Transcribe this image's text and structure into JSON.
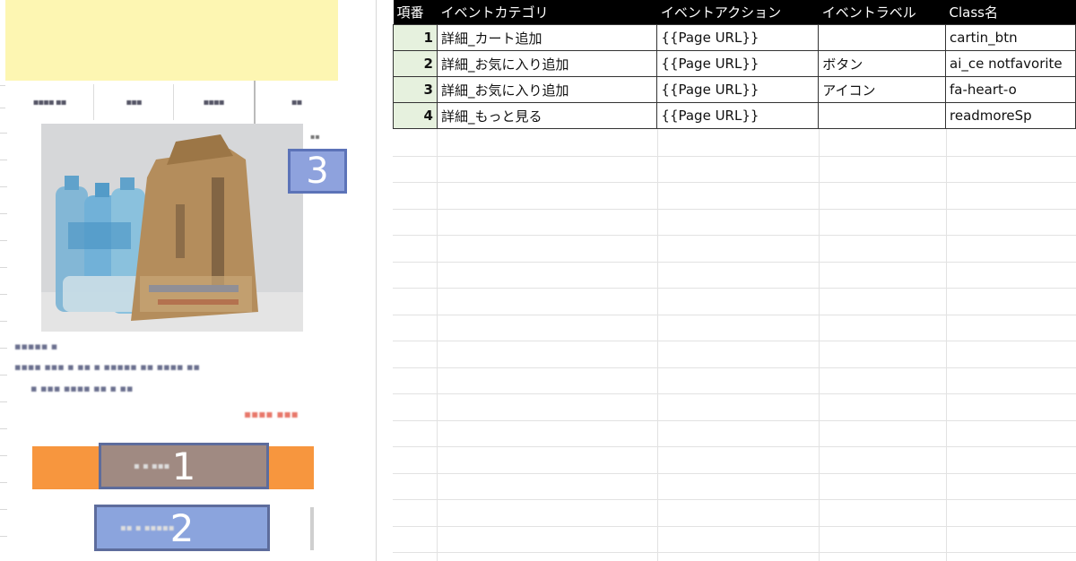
{
  "phone": {
    "tabs": [
      "▪▪▪▪ ▪▪",
      "▪▪▪",
      "▪▪▪▪",
      "▪▪"
    ],
    "marker3": "3",
    "marker3_tag": "▪▪",
    "product_title": "▪▪▪▪▪ ▪",
    "product_desc_1": "▪▪▪▪ ▪▪▪ ▪ ▪▪ ▪ ▪▪▪▪▪ ▪▪ ▪▪▪▪ ▪▪",
    "product_desc_2": "▪ ▪▪▪ ▪▪▪▪ ▪▪ ▪ ▪▪",
    "product_price": "▪▪▪▪ ▪▪▪",
    "marker1": "1",
    "marker1_label": "▪ ▪ ▪▪▪",
    "marker2": "2",
    "marker2_label": "▪▪ ▪ ▪▪▪▪▪",
    "colors": {
      "banner": "#fdf6b2",
      "cart_button": "#f7963e",
      "marker1": "#a08a82",
      "marker2": "#8ba4dd",
      "marker3": "#8ea2dd",
      "marker_border": "#5d6c9c"
    }
  },
  "sheet": {
    "headers": [
      "項番",
      "イベントカテゴリ",
      "イベントアクション",
      "イベントラベル",
      "Class名"
    ],
    "rows": [
      {
        "no": "1",
        "category": "詳細_カート追加",
        "action": "{{Page URL}}",
        "label": "",
        "class": "cartin_btn"
      },
      {
        "no": "2",
        "category": "詳細_お気に入り追加",
        "action": "{{Page URL}}",
        "label": "ボタン",
        "class": "ai_ce notfavorite"
      },
      {
        "no": "3",
        "category": "詳細_お気に入り追加",
        "action": "{{Page URL}}",
        "label": "アイコン",
        "class": "fa-heart-o"
      },
      {
        "no": "4",
        "category": "詳細_もっと見る",
        "action": "{{Page URL}}",
        "label": "",
        "class": "readmoreSp"
      }
    ],
    "colors": {
      "header_bg": "#000000",
      "number_cell_bg": "#e6f1de"
    }
  }
}
